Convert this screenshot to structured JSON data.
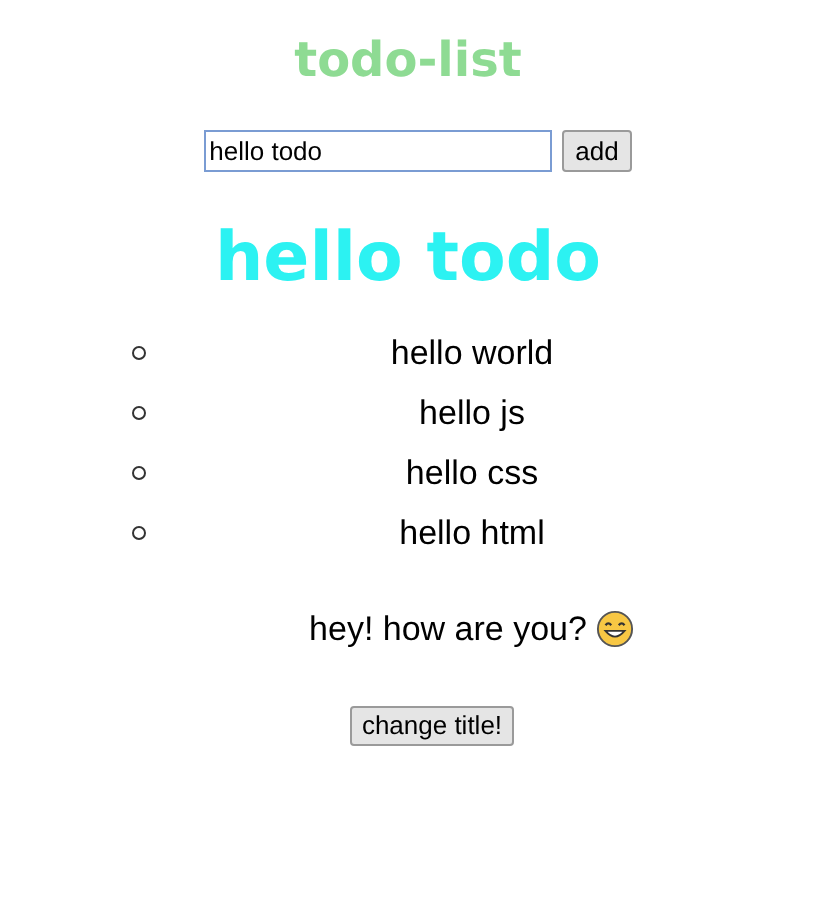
{
  "title": "todo-list",
  "input": {
    "value": "hello todo"
  },
  "add_button": "add",
  "heading": "hello todo",
  "todos": [
    "hello world",
    "hello js",
    "hello css",
    "hello html"
  ],
  "message": "hey! how are you?",
  "change_button": "change title!"
}
